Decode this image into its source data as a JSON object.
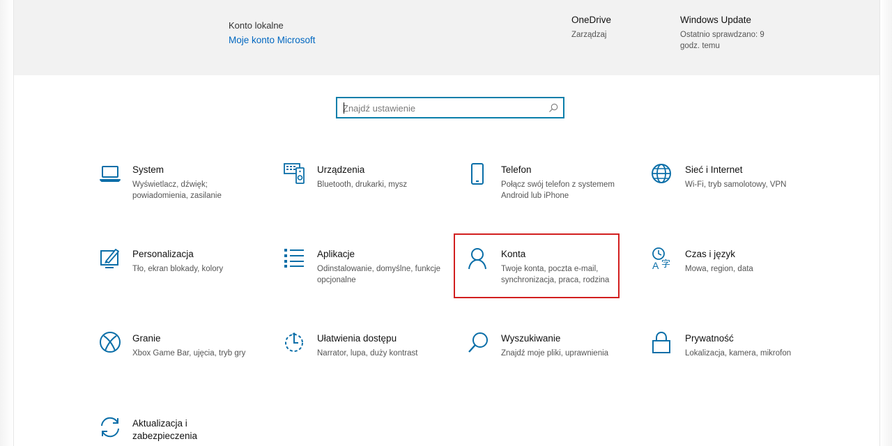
{
  "header": {
    "account_type": "Konto lokalne",
    "account_link": "Moje konto Microsoft",
    "onedrive": {
      "title": "OneDrive",
      "subtitle": "Zarządzaj"
    },
    "windows_update": {
      "title": "Windows Update",
      "subtitle": "Ostatnio sprawdzano: 9 godz. temu"
    }
  },
  "search": {
    "placeholder": "Znajdź ustawienie",
    "value": ""
  },
  "colors": {
    "accent": "#0067c0",
    "icon": "#0a6ea8",
    "highlight": "#d21f1f",
    "header_bg": "#f2f2f2"
  },
  "tiles": [
    {
      "title": "System",
      "desc": "Wyświetlacz, dźwięk; powiadomienia, zasilanie",
      "icon": "laptop-icon"
    },
    {
      "title": "Urządzenia",
      "desc": "Bluetooth, drukarki, mysz",
      "icon": "devices-icon"
    },
    {
      "title": "Telefon",
      "desc": "Połącz swój telefon z systemem Android lub iPhone",
      "icon": "phone-icon"
    },
    {
      "title": "Sieć i Internet",
      "desc": "Wi-Fi, tryb samolotowy, VPN",
      "icon": "globe-icon"
    },
    {
      "title": "Personalizacja",
      "desc": "Tło, ekran blokady, kolory",
      "icon": "paint-icon"
    },
    {
      "title": "Aplikacje",
      "desc": "Odinstalowanie, domyślne, funkcje opcjonalne",
      "icon": "apps-list-icon"
    },
    {
      "title": "Konta",
      "desc": "Twoje konta, poczta e-mail, synchronizacja, praca, rodzina",
      "icon": "person-icon"
    },
    {
      "title": "Czas i język",
      "desc": "Mowa, region, data",
      "icon": "time-language-icon"
    },
    {
      "title": "Granie",
      "desc": "Xbox Game Bar, ujęcia, tryb gry",
      "icon": "xbox-icon"
    },
    {
      "title": "Ułatwienia dostępu",
      "desc": "Narrator, lupa, duży kontrast",
      "icon": "ease-of-access-icon"
    },
    {
      "title": "Wyszukiwanie",
      "desc": "Znajdź moje pliki, uprawnienia",
      "icon": "search-icon"
    },
    {
      "title": "Prywatność",
      "desc": "Lokalizacja, kamera, mikrofon",
      "icon": "lock-icon"
    },
    {
      "title": "Aktualizacja i zabezpieczenia",
      "desc": "",
      "icon": "update-icon"
    }
  ]
}
